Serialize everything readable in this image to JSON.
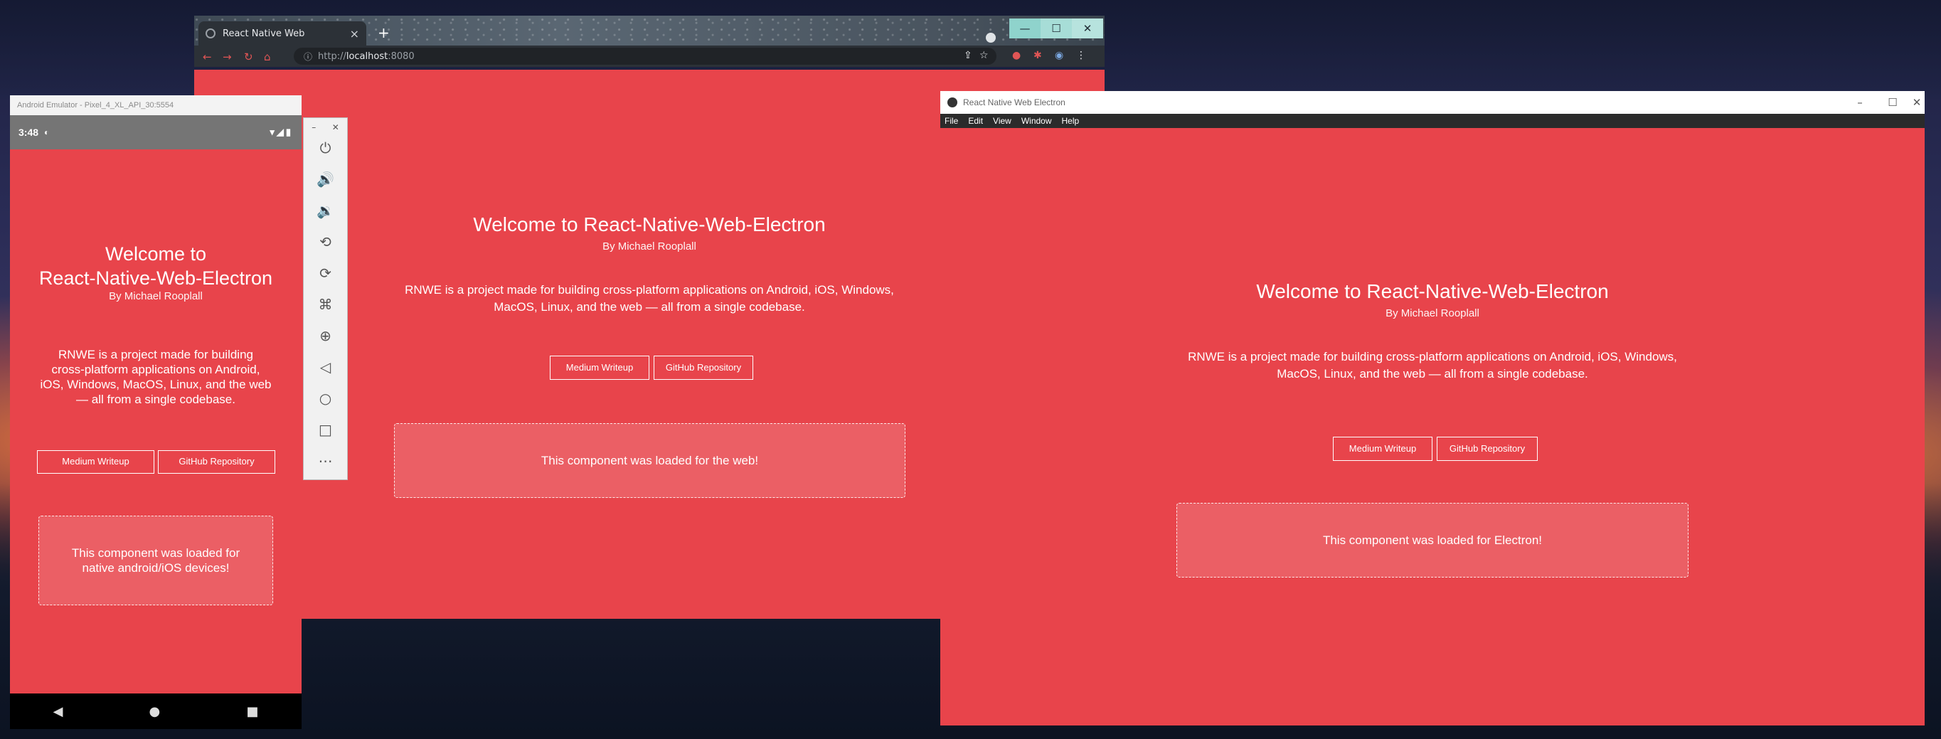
{
  "content": {
    "welcome_full": "Welcome to React-Native-Web-Electron",
    "welcome_line1": "Welcome to",
    "welcome_line2": "React-Native-Web-Electron",
    "byline": "By Michael Rooplall",
    "description_line1": "RNWE is a project made for building cross-platform applications on Android, iOS, Windows,",
    "description_line2": "MacOS, Linux, and the web — all from a single codebase.",
    "mobile_desc_1": "RNWE is a project made for building",
    "mobile_desc_2": "cross-platform applications on Android,",
    "mobile_desc_3": "iOS, Windows, MacOS, Linux, and the web",
    "mobile_desc_4": "— all from a single codebase.",
    "medium_button": "Medium Writeup",
    "github_button": "GitHub Repository"
  },
  "browser": {
    "tab_title": "React Native Web",
    "url_prefix": "http://",
    "url_host": "localhost",
    "url_port": ":8080",
    "loaded_message": "This component was loaded for the web!"
  },
  "emulator": {
    "window_title": "Android Emulator - Pixel_4_XL_API_30:5554",
    "time": "3:48",
    "loaded_line1": "This component was loaded for",
    "loaded_line2": "native android/iOS devices!"
  },
  "electron": {
    "window_title": "React Native Web Electron",
    "menu": [
      "File",
      "Edit",
      "View",
      "Window",
      "Help"
    ],
    "loaded_message": "This component was loaded for Electron!"
  },
  "colors": {
    "app_background": "#e8444b"
  }
}
